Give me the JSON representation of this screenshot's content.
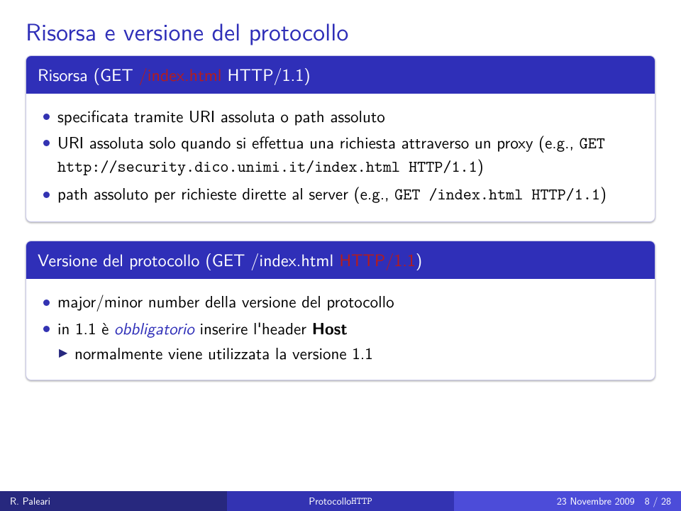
{
  "slide": {
    "title": "Risorsa e versione del protocollo"
  },
  "blocks": {
    "risorsa": {
      "heading_prefix": "Risorsa (GET ",
      "heading_mid": "/index.html",
      "heading_suffix": " HTTP/1.1)",
      "item1": "specificata tramite URI assoluta o path assoluto",
      "item2_pre": "URI assoluta solo quando si effettua una richiesta attraverso un proxy (e.g., ",
      "item2_code": "GET http://security.dico.unimi.it/index.html HTTP/1.1",
      "item2_post": ")",
      "item3_pre": "path assoluto per richieste dirette al server (e.g., ",
      "item3_code": "GET /index.html HTTP/1.1",
      "item3_post": ")"
    },
    "versione": {
      "heading_prefix": "Versione del protocollo (GET /index.html ",
      "heading_mid": "HTTP/1.1",
      "heading_suffix": ")",
      "item1": "major/minor number della versione del protocollo",
      "item2_pre": "in 1.1 è ",
      "item2_emph": "obbligatorio",
      "item2_mid": " inserire l'header ",
      "item2_bold": "Host",
      "sub1": "normalmente viene utilizzata la versione 1.1"
    }
  },
  "footer": {
    "author": "R. Paleari",
    "center_text": "Protocollo ",
    "center_code": "HTTP",
    "date": "23 Novembre 2009",
    "page_current": "8",
    "page_sep": " / ",
    "page_total": "28"
  }
}
